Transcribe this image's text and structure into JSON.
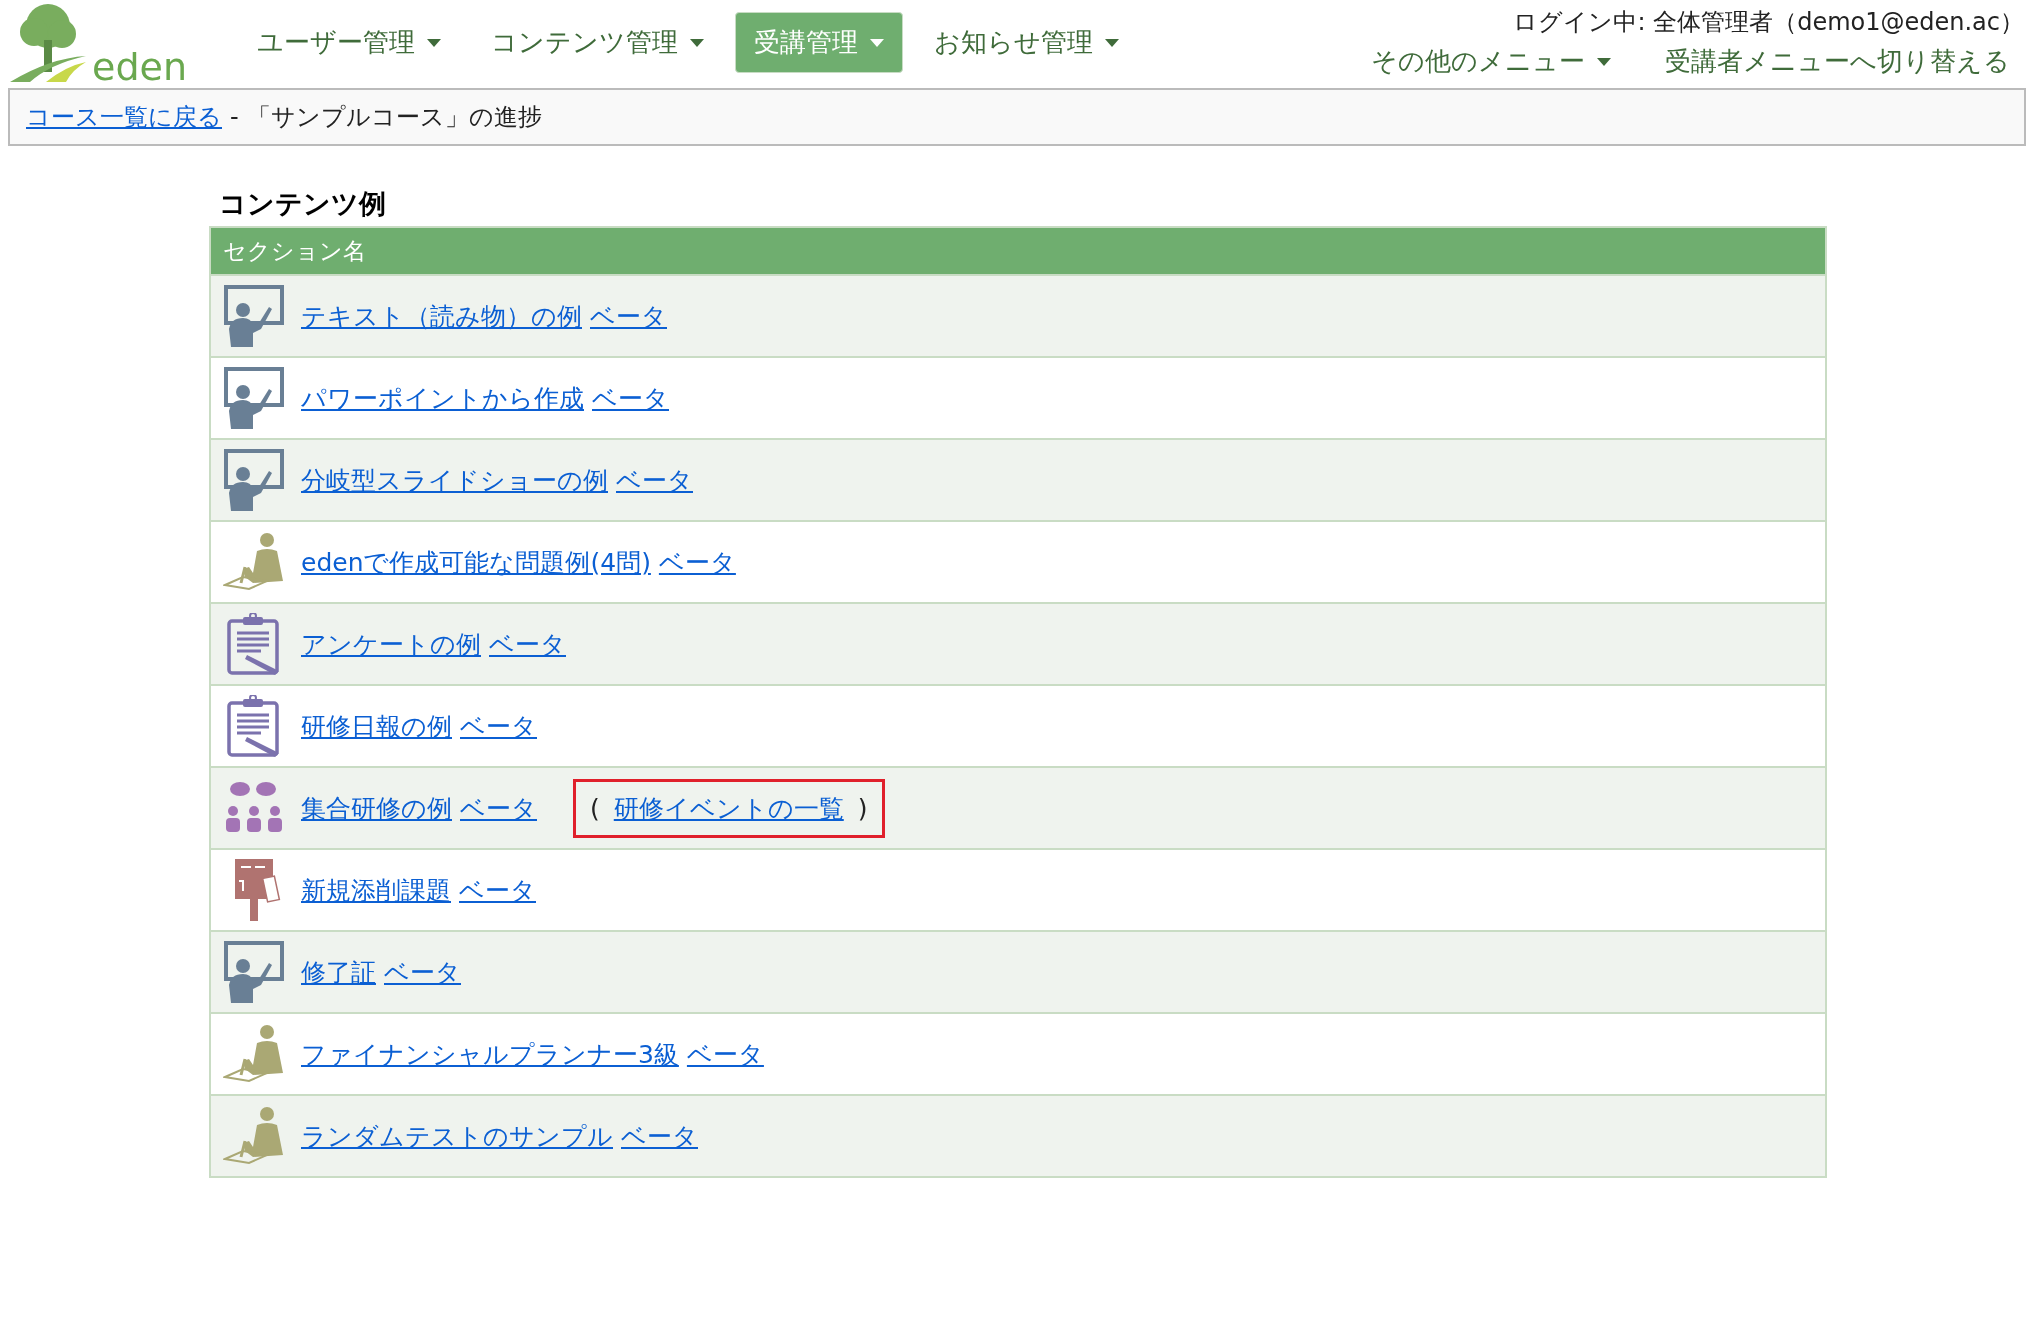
{
  "header": {
    "logo_text": "eden",
    "nav": [
      {
        "label": "ユーザー管理",
        "selected": false,
        "dropdown": true
      },
      {
        "label": "コンテンツ管理",
        "selected": false,
        "dropdown": true
      },
      {
        "label": "受講管理",
        "selected": true,
        "dropdown": true
      },
      {
        "label": "お知らせ管理",
        "selected": false,
        "dropdown": true
      }
    ],
    "login_status": "ログイン中: 全体管理者（demo1@eden.ac）",
    "right_menu": [
      {
        "label": "その他のメニュー",
        "dropdown": true
      },
      {
        "label": "受講者メニューへ切り替える",
        "dropdown": false
      }
    ]
  },
  "breadcrumb": {
    "link": "コース一覧に戻る",
    "separator": "-",
    "current": "「サンプルコース」の進捗"
  },
  "section_title": "コンテンツ例",
  "table": {
    "column": "セクション名",
    "rows": [
      {
        "kind": "lecture",
        "title": "テキスト（読み物）の例",
        "badge": "ベータ"
      },
      {
        "kind": "lecture",
        "title": "パワーポイントから作成",
        "badge": "ベータ"
      },
      {
        "kind": "lecture",
        "title": "分岐型スライドショーの例",
        "badge": "ベータ"
      },
      {
        "kind": "exam",
        "title": "edenで作成可能な問題例(4問)",
        "badge": "ベータ"
      },
      {
        "kind": "survey",
        "title": "アンケートの例",
        "badge": "ベータ"
      },
      {
        "kind": "survey",
        "title": "研修日報の例",
        "badge": "ベータ"
      },
      {
        "kind": "group",
        "title": "集合研修の例",
        "badge": "ベータ",
        "extra": {
          "open": "(",
          "link": "研修イベントの一覧",
          "close": ")",
          "highlighted": true
        }
      },
      {
        "kind": "post",
        "title": "新規添削課題",
        "badge": "ベータ"
      },
      {
        "kind": "lecture",
        "title": "修了証",
        "badge": "ベータ"
      },
      {
        "kind": "exam",
        "title": "ファイナンシャルプランナー3級",
        "badge": "ベータ"
      },
      {
        "kind": "exam",
        "title": "ランダムテストのサンプル",
        "badge": "ベータ"
      }
    ]
  }
}
